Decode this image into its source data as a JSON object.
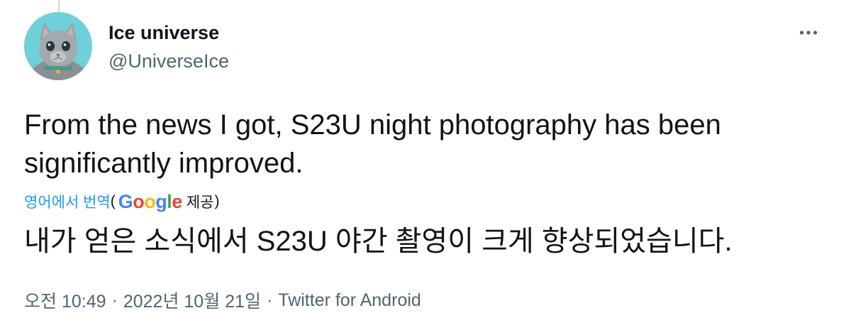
{
  "tweet": {
    "author": {
      "display_name": "Ice universe",
      "handle": "@UniverseIce",
      "avatar_icon": "cat-avatar"
    },
    "more_icon": "more-horizontal-icon",
    "text_lines": [
      "From the news I got, S23U night photography has been",
      "significantly improved."
    ],
    "translation": {
      "link_label": "영어에서 번역",
      "open_paren": "(",
      "provider_logo_text": "Google",
      "provided_label": "제공",
      "close_paren": ")",
      "translated_text": "내가 얻은 소식에서 S23U 야간 촬영이 크게 향상되었습니다."
    },
    "meta": {
      "time": "오전 10:49",
      "separator": "·",
      "date": "2022년 10월 21일",
      "source": "Twitter for Android"
    }
  },
  "colors": {
    "text_primary": "#0f1419",
    "text_secondary": "#536471",
    "link": "#1d9bf0",
    "avatar_background": "#6ed0d8"
  }
}
